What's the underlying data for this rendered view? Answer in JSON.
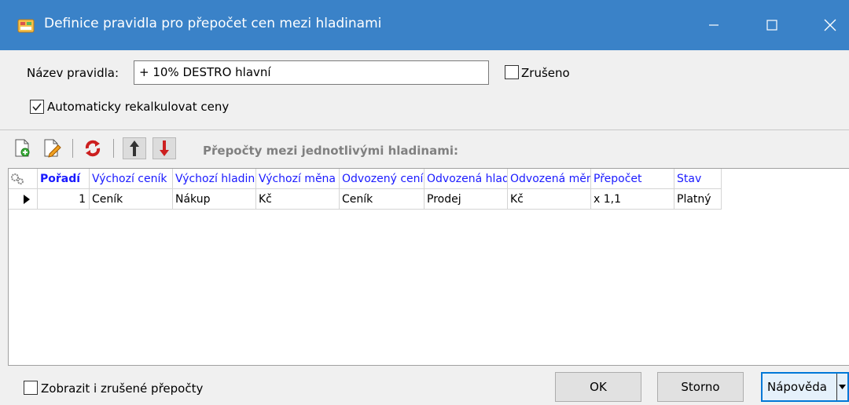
{
  "window": {
    "title": "Definice pravidla pro přepočet cen mezi hladinami",
    "minimize_glyph": "—",
    "maximize_glyph": "☐",
    "close_glyph": "✕"
  },
  "form": {
    "name_label": "Název pravidla:",
    "name_value": "+ 10% DESTRO hlavní",
    "cancelled_label": "Zrušeno",
    "cancelled_checked": false,
    "auto_recalc_label": "Automaticky rekalkulovat ceny",
    "auto_recalc_checked": true
  },
  "toolbar": {
    "icons": [
      "new-document-icon",
      "edit-document-icon",
      "refresh-icon",
      "move-up-icon",
      "move-down-icon"
    ],
    "caption": "Přepočty mezi jednotlivými hladinami:"
  },
  "grid": {
    "columns": [
      "Pořadí",
      "Výchozí ceník",
      "Výchozí hladina",
      "Výchozí měna",
      "Odvozený ceník",
      "Odvozená hladina",
      "Odvozená měna",
      "Přepočet",
      "Stav"
    ],
    "rows": [
      {
        "order": "1",
        "src_pricelist": "Ceník",
        "src_level": "Nákup",
        "src_currency": "Kč",
        "dst_pricelist": "Ceník",
        "dst_level": "Prodej",
        "dst_currency": "Kč",
        "conversion": "x 1,1",
        "status": "Platný"
      }
    ]
  },
  "footer": {
    "show_cancelled_label": "Zobrazit i zrušené přepočty",
    "show_cancelled_checked": false,
    "ok_label": "OK",
    "cancel_label": "Storno",
    "help_label": "Nápověda"
  },
  "colors": {
    "titlebar": "#3a82c8",
    "header_text": "#1a1aff",
    "default_button_border": "#0078d7"
  }
}
